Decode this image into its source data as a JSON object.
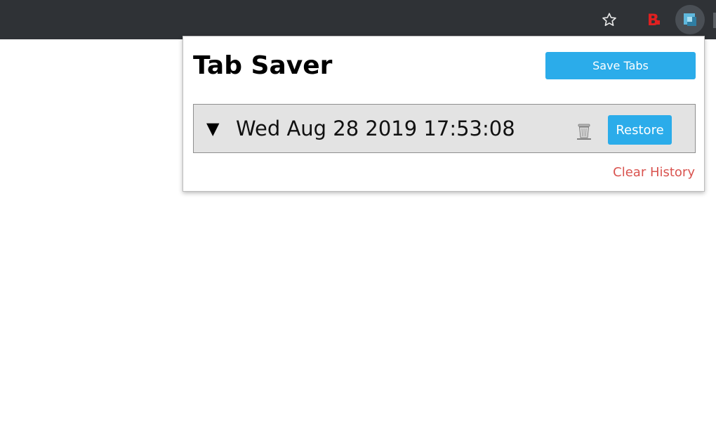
{
  "toolbar": {
    "icons": [
      {
        "name": "star-icon"
      },
      {
        "name": "b-extension-icon",
        "label": "B",
        "color": "#e02020"
      },
      {
        "name": "tab-saver-extension-icon",
        "color": "#4aa3c8"
      }
    ]
  },
  "popup": {
    "title": "Tab Saver",
    "save_label": "Save Tabs",
    "accent": "#2bacea",
    "sessions": [
      {
        "toggle": "▼",
        "date": "Wed Aug 28 2019 17:53:08",
        "restore_label": "Restore",
        "delete_icon": "trash-icon"
      }
    ],
    "clear_history_label": "Clear History",
    "clear_color": "#d9534f"
  }
}
